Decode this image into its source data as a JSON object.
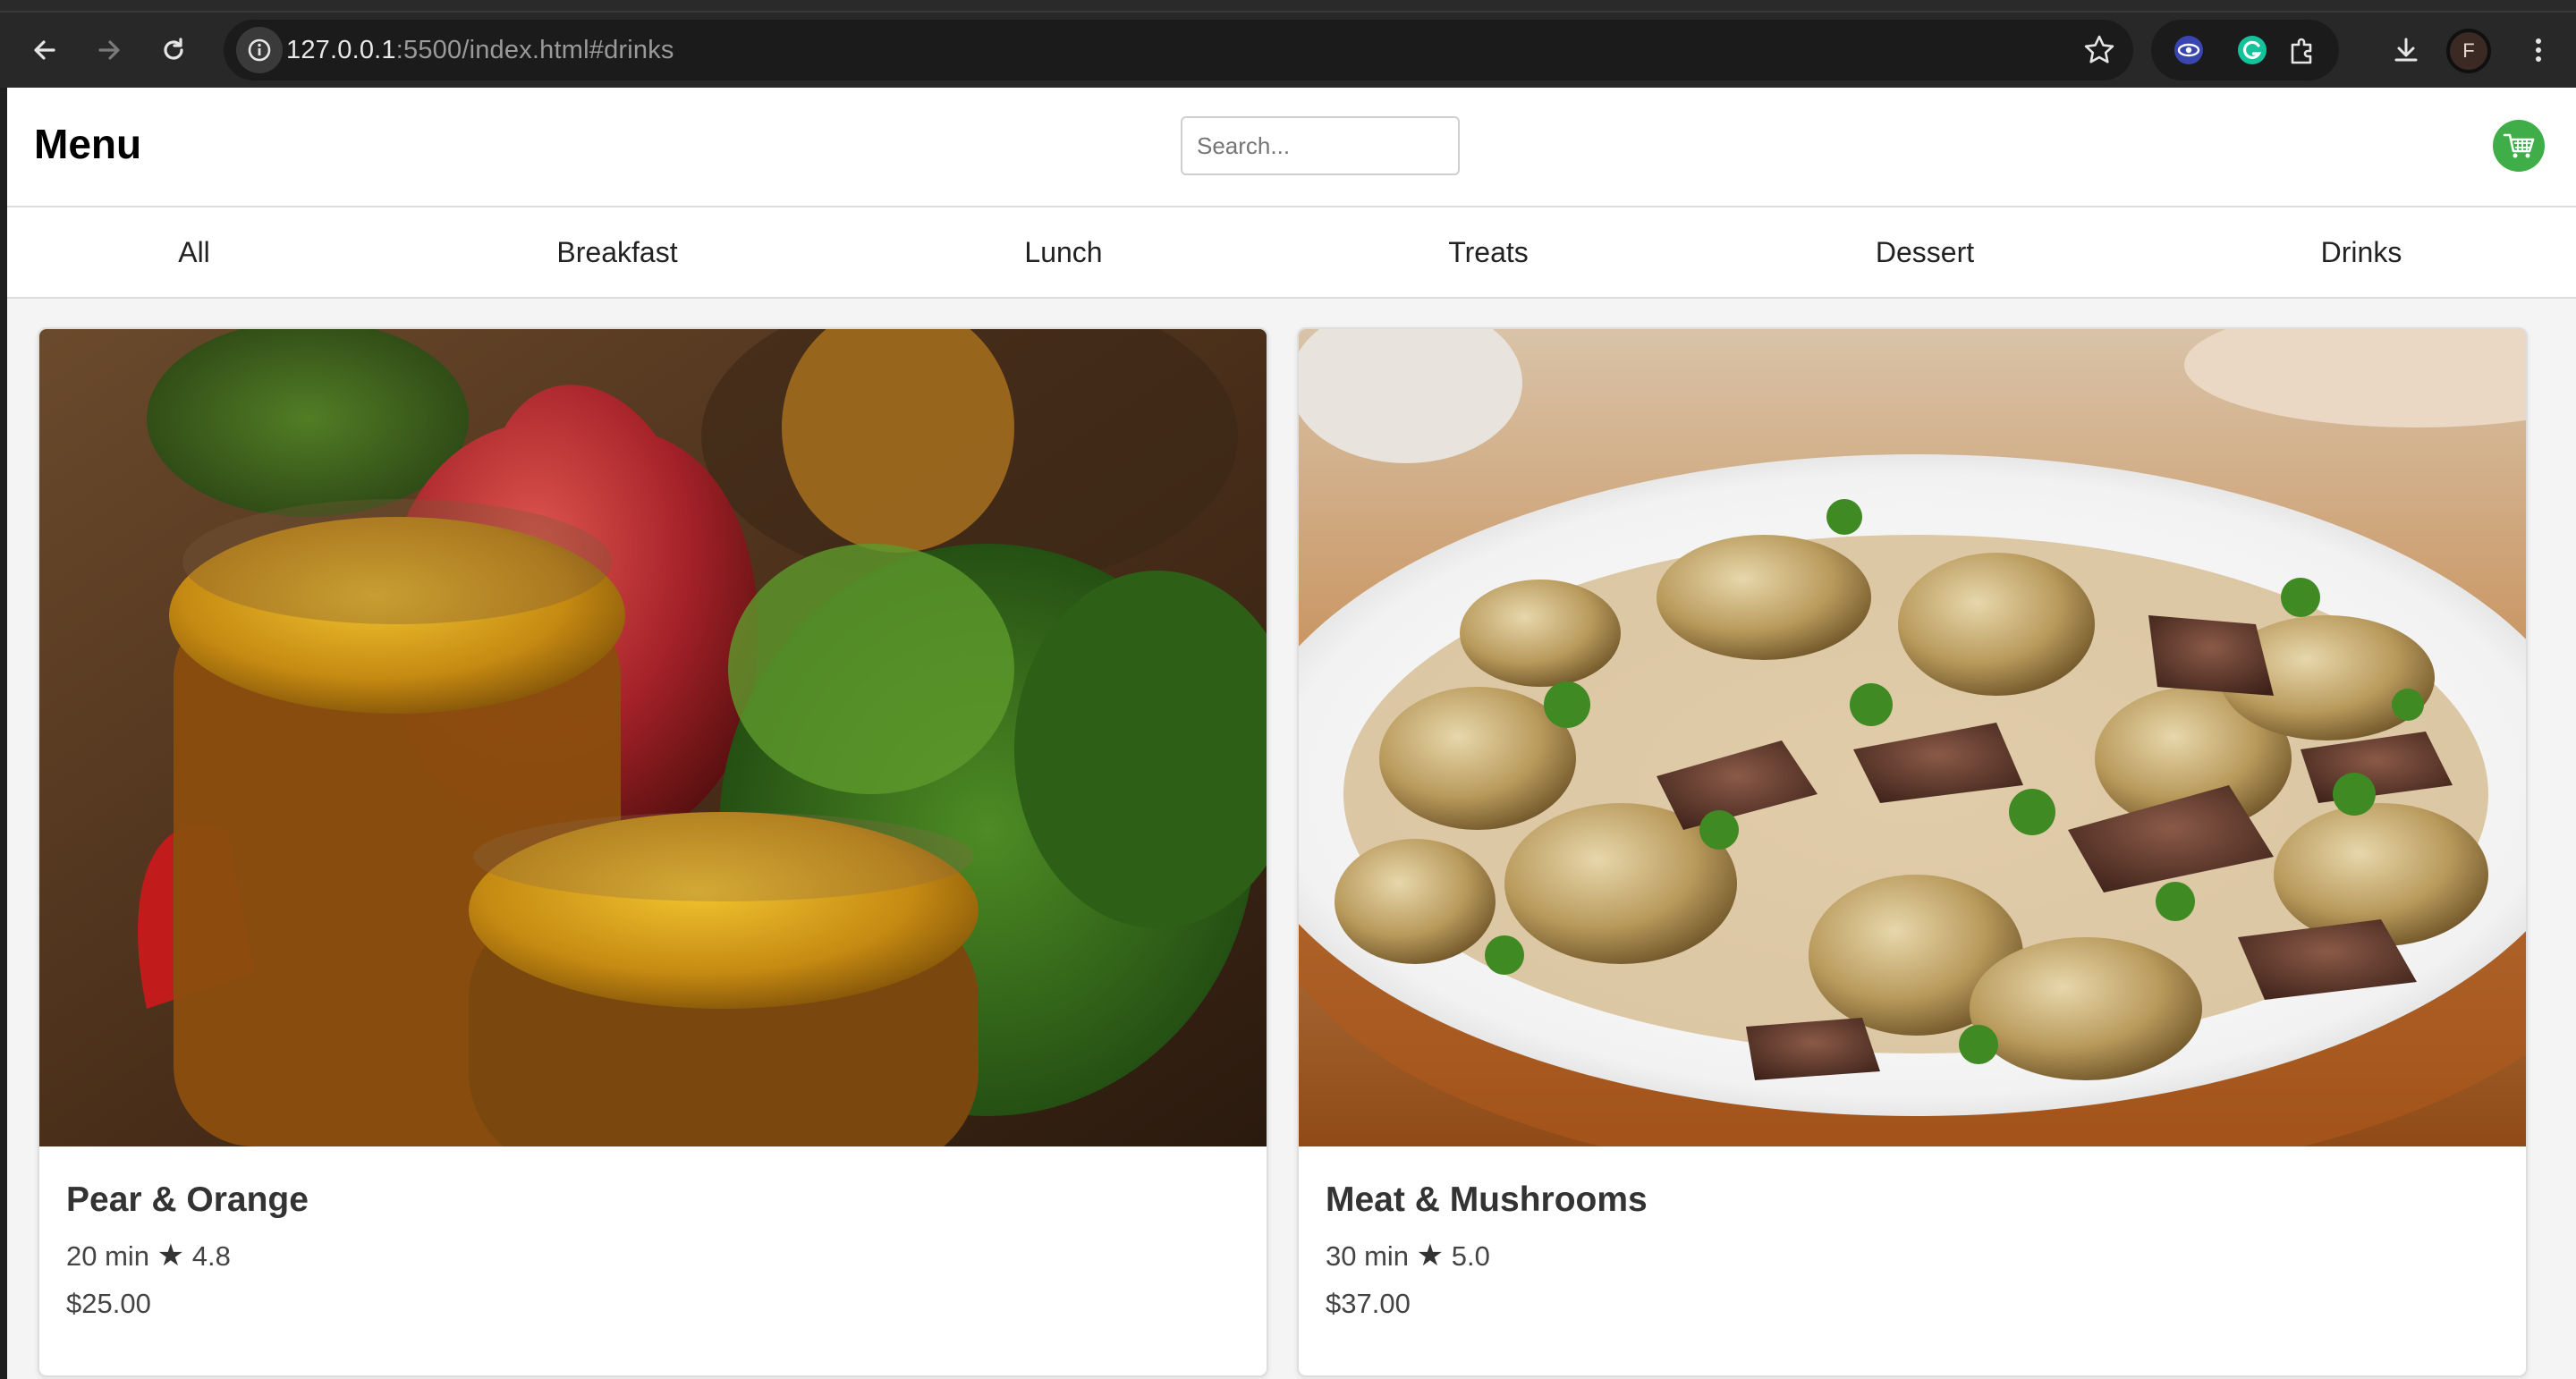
{
  "browser": {
    "url_host": "127.0.0.1",
    "url_rest": ":5500/index.html#drinks",
    "profile_initial": "F"
  },
  "header": {
    "title": "Menu",
    "search_placeholder": "Search...",
    "cart_icon": "cart-icon",
    "accent_color": "#3fae49"
  },
  "nav": {
    "items": [
      "All",
      "Breakfast",
      "Lunch",
      "Treats",
      "Dessert",
      "Drinks"
    ]
  },
  "cards": [
    {
      "name": "Pear & Orange",
      "time": "20 min",
      "rating": "4.8",
      "price": "$25.00",
      "image": "pear-orange-chutney-photo"
    },
    {
      "name": "Meat & Mushrooms",
      "time": "30 min",
      "rating": "5.0",
      "price": "$37.00",
      "image": "meat-mushrooms-photo"
    }
  ]
}
